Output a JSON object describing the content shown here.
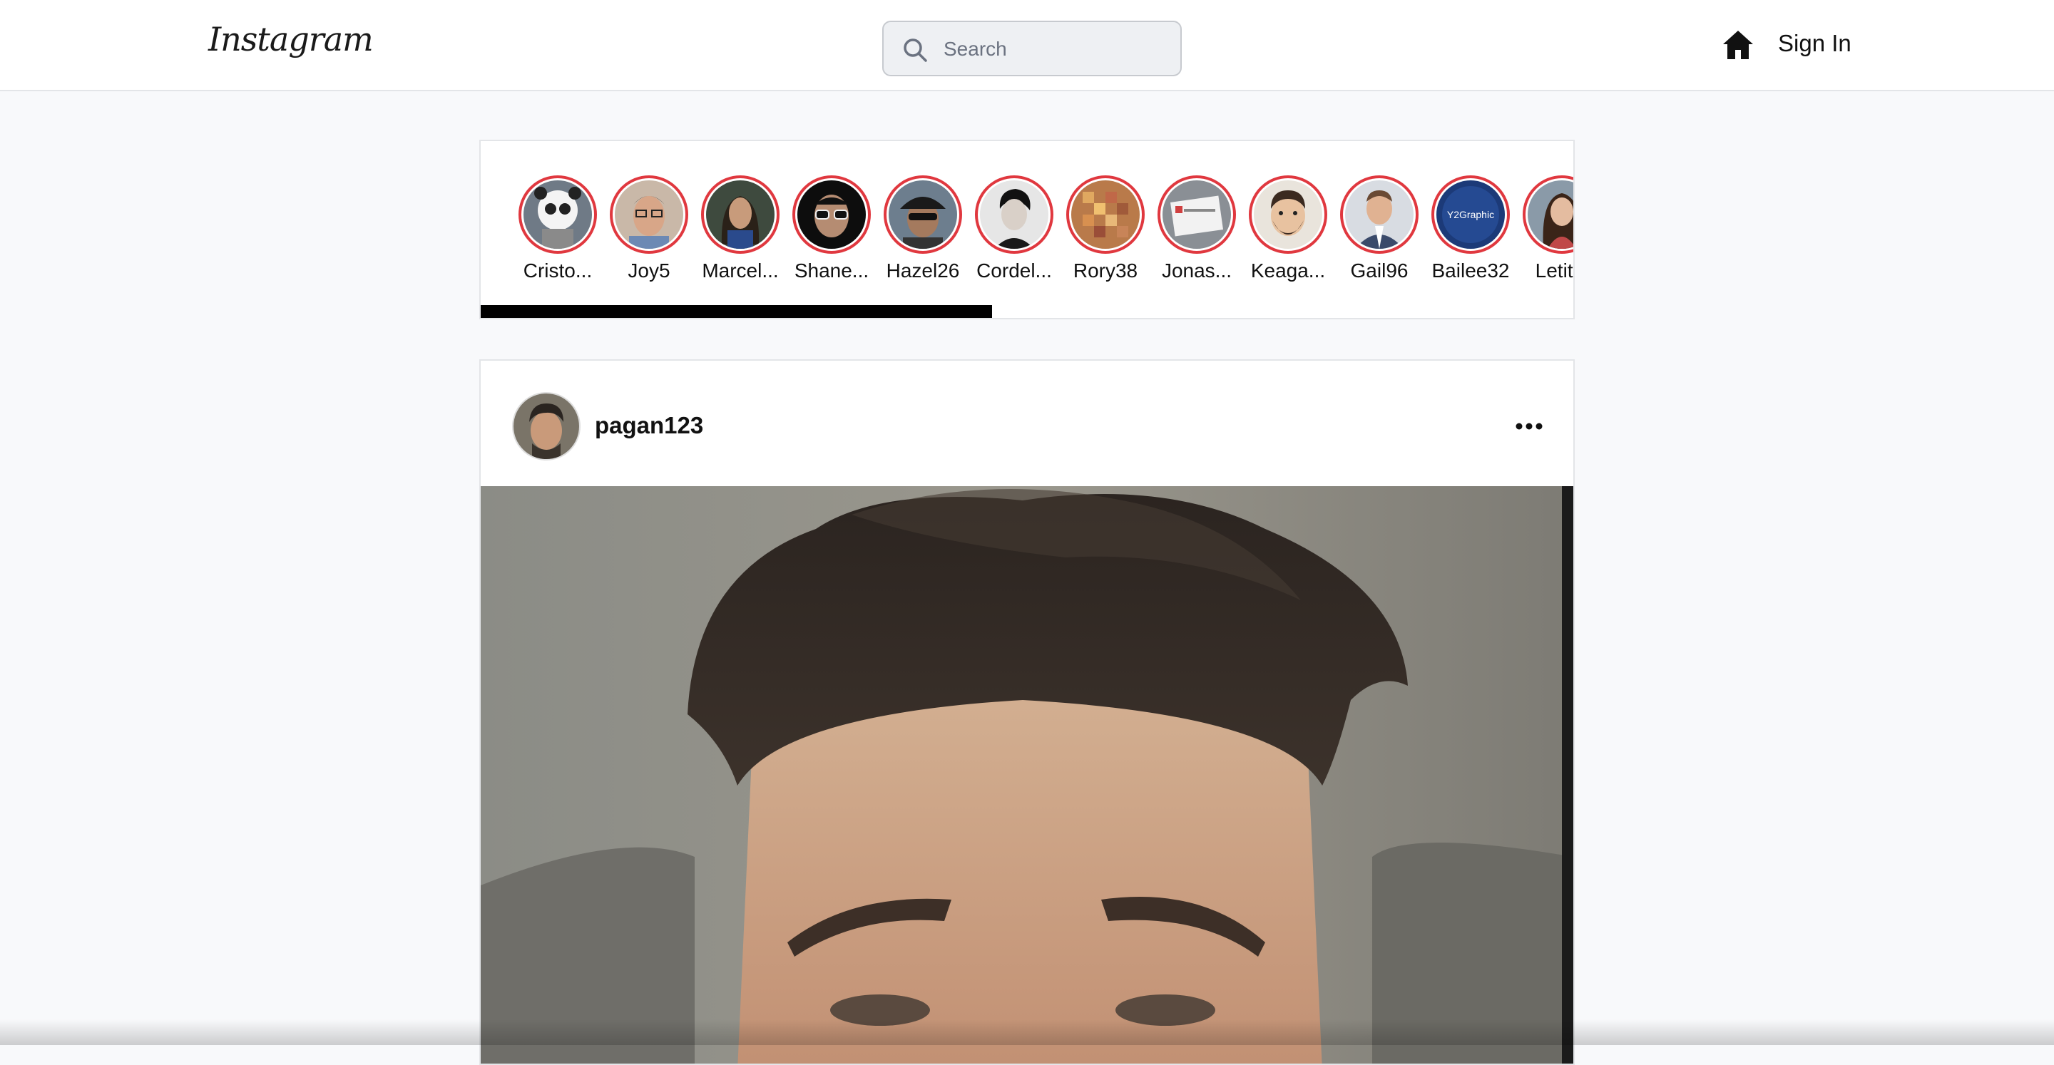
{
  "header": {
    "logo_text": "Instagram",
    "search_placeholder": "Search",
    "search_value": "",
    "sign_in_label": "Sign In"
  },
  "stories": {
    "scroll_fraction": 0.467,
    "items": [
      {
        "name": "Cristo...",
        "icon": "panda-mask-avatar"
      },
      {
        "name": "Joy5",
        "icon": "glasses-man-avatar"
      },
      {
        "name": "Marcel...",
        "icon": "long-hair-avatar"
      },
      {
        "name": "Shane...",
        "icon": "glasses-dark-avatar"
      },
      {
        "name": "Hazel26",
        "icon": "cap-sunglasses-avatar"
      },
      {
        "name": "Cordel...",
        "icon": "bw-portrait-avatar"
      },
      {
        "name": "Rory38",
        "icon": "pixel-avatar"
      },
      {
        "name": "Jonas...",
        "icon": "sign-holding-avatar"
      },
      {
        "name": "Keaga...",
        "icon": "cartoon-beard-avatar"
      },
      {
        "name": "Gail96",
        "icon": "suit-man-avatar"
      },
      {
        "name": "Bailee32",
        "icon": "y2graphic-logo-avatar",
        "avatar_text": "Y2Graphic"
      },
      {
        "name": "Letitia",
        "icon": "woman-portrait-avatar"
      }
    ]
  },
  "post": {
    "username": "pagan123",
    "more_icon": "more-horizontal-icon"
  },
  "colors": {
    "story_ring": "#e0383f",
    "background": "#f8f9fb",
    "scroll_thumb": "#000000"
  }
}
